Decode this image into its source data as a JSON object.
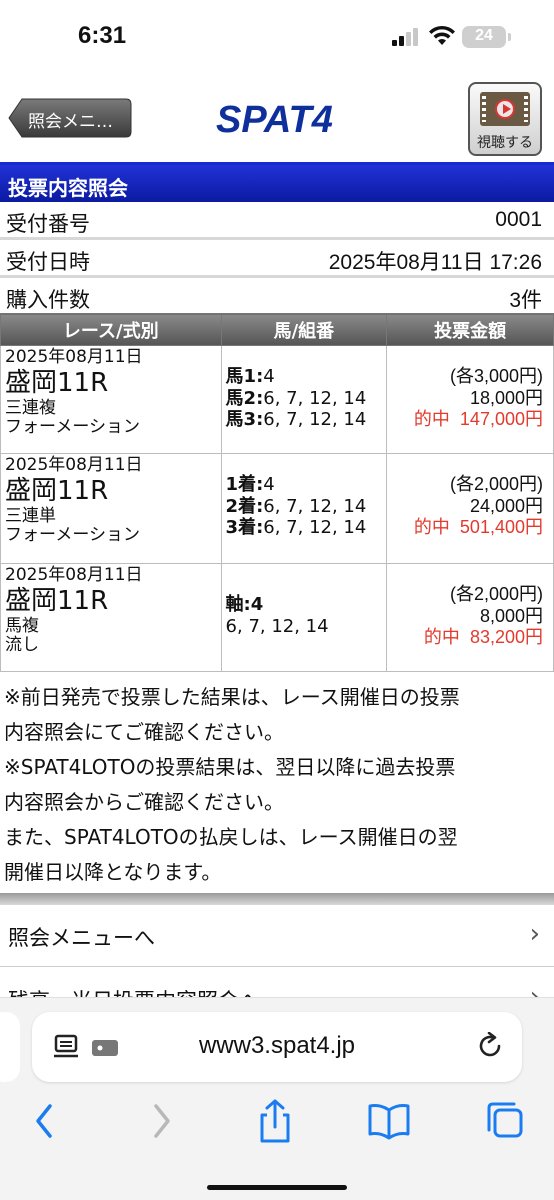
{
  "status": {
    "time": "6:31",
    "battery": "24"
  },
  "header": {
    "back_label": "照会メニ…",
    "logo": "SPAT4",
    "watch_label": "視聴する"
  },
  "section_title": "投票内容照会",
  "info": [
    {
      "key": "受付番号",
      "value": "0001"
    },
    {
      "key": "受付日時",
      "value": "2025年08月11日 17:26"
    },
    {
      "key": "購入件数",
      "value": "3件"
    }
  ],
  "table": {
    "headers": [
      "レース/式別",
      "馬/組番",
      "投票金額"
    ],
    "rows": [
      {
        "date": "2025年08月11日",
        "race": "盛岡11R",
        "type1": "三連複",
        "type2": "フォーメーション",
        "lines": [
          {
            "b": "馬1:",
            "t": "4"
          },
          {
            "b": "馬2:",
            "t": "6, 7, 12, 14"
          },
          {
            "b": "馬3:",
            "t": "6, 7, 12, 14"
          }
        ],
        "each": "(各3,000円)",
        "total": "18,000円",
        "hit_label": "的中",
        "payout": "147,000円"
      },
      {
        "date": "2025年08月11日",
        "race": "盛岡11R",
        "type1": "三連単",
        "type2": "フォーメーション",
        "lines": [
          {
            "b": "1着:",
            "t": "4"
          },
          {
            "b": "2着:",
            "t": "6, 7, 12, 14"
          },
          {
            "b": "3着:",
            "t": "6, 7, 12, 14"
          }
        ],
        "each": "(各2,000円)",
        "total": "24,000円",
        "hit_label": "的中",
        "payout": "501,400円"
      },
      {
        "date": "2025年08月11日",
        "race": "盛岡11R",
        "type1": "馬複",
        "type2": "流し",
        "lines": [
          {
            "b": "軸:4",
            "t": ""
          },
          {
            "b": "",
            "t": "6, 7, 12, 14"
          }
        ],
        "each": "(各2,000円)",
        "total": "8,000円",
        "hit_label": "的中",
        "payout": "83,200円"
      }
    ]
  },
  "notes": [
    "※前日発売で投票した結果は、レース開催日の投票",
    "内容照会にてご確認ください。",
    "※SPAT4LOTOの投票結果は、翌日以降に過去投票",
    "内容照会からご確認ください。",
    "また、SPAT4LOTOの払戻しは、レース開催日の翌",
    "開催日以降となります。"
  ],
  "menu": [
    "照会メニューへ",
    "残高・当日投票内容照会へ"
  ],
  "browser": {
    "url": "www3.spat4.jp"
  },
  "colors": {
    "header_blue": "#1424c0",
    "hit_red": "#e23b2e",
    "ios_blue": "#1a7cf0"
  }
}
